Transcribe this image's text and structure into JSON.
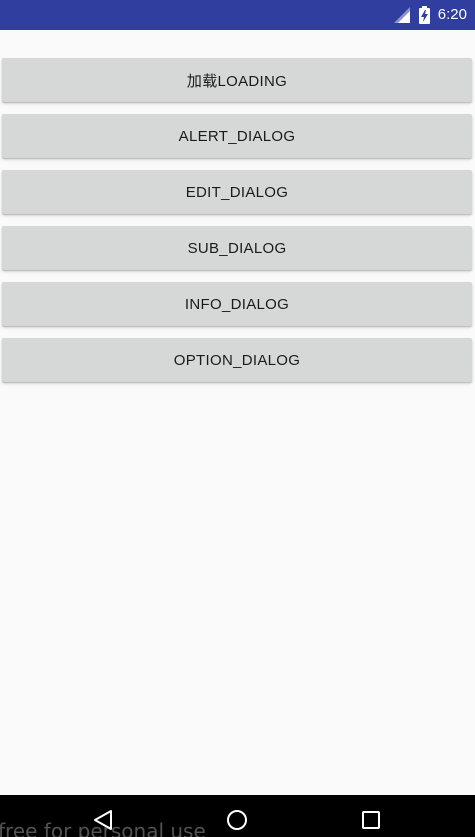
{
  "status_bar": {
    "time": "6:20",
    "icons": [
      "signal-icon",
      "battery-charging-icon"
    ],
    "color": "#303f9f"
  },
  "buttons": [
    {
      "label": "加载LOADING"
    },
    {
      "label": "ALERT_DIALOG"
    },
    {
      "label": "EDIT_DIALOG"
    },
    {
      "label": "SUB_DIALOG"
    },
    {
      "label": "INFO_DIALOG"
    },
    {
      "label": "OPTION_DIALOG"
    }
  ],
  "nav_bar": {
    "icons": [
      "back-icon",
      "home-icon",
      "recents-icon"
    ],
    "watermark": "free for personal use"
  }
}
